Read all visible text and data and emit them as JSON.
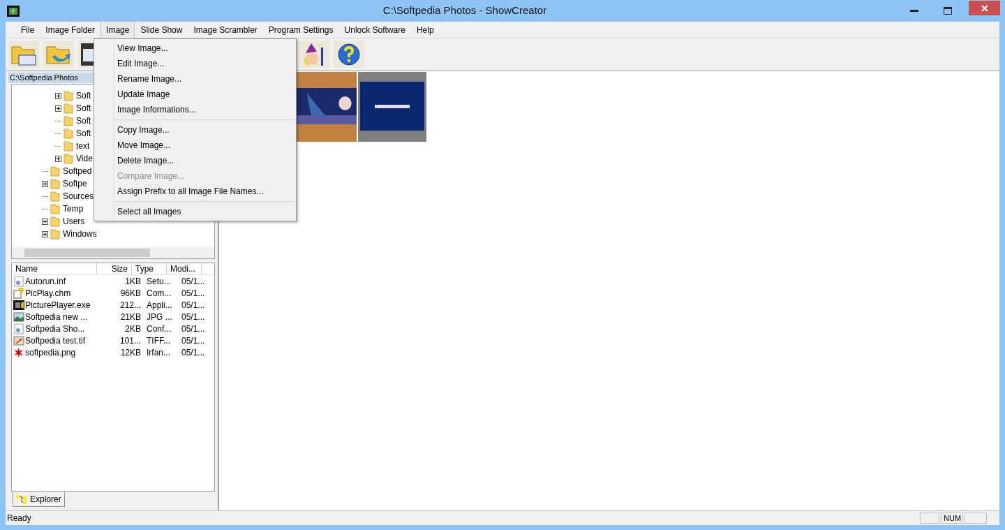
{
  "window": {
    "title": "C:\\Softpedia Photos - ShowCreator"
  },
  "menu_bar": [
    {
      "label": "File",
      "selected": false
    },
    {
      "label": "Image Folder",
      "selected": false
    },
    {
      "label": "Image",
      "selected": true
    },
    {
      "label": "Slide Show",
      "selected": false
    },
    {
      "label": "Image Scrambler",
      "selected": false
    },
    {
      "label": "Program Settings",
      "selected": false
    },
    {
      "label": "Unlock Software",
      "selected": false
    },
    {
      "label": "Help",
      "selected": false
    }
  ],
  "image_menu": [
    {
      "kind": "item",
      "label": "View Image...",
      "disabled": false
    },
    {
      "kind": "item",
      "label": "Edit Image...",
      "disabled": false
    },
    {
      "kind": "item",
      "label": "Rename Image...",
      "disabled": false
    },
    {
      "kind": "item",
      "label": "Update Image",
      "disabled": false
    },
    {
      "kind": "item",
      "label": "Image Informations...",
      "disabled": false
    },
    {
      "kind": "separator"
    },
    {
      "kind": "item",
      "label": "Copy Image...",
      "disabled": false
    },
    {
      "kind": "item",
      "label": "Move Image...",
      "disabled": false
    },
    {
      "kind": "item",
      "label": "Delete Image...",
      "disabled": false
    },
    {
      "kind": "item",
      "label": "Compare Image...",
      "disabled": true
    },
    {
      "kind": "item",
      "label": "Assign Prefix to all Image File Names...",
      "disabled": false
    },
    {
      "kind": "separator"
    },
    {
      "kind": "item",
      "label": "Select all Images",
      "disabled": false
    }
  ],
  "path_bar": "C:\\Softpedia Photos",
  "tree": {
    "deeper_items": [
      {
        "label": "Soft",
        "expandable": true
      },
      {
        "label": "Soft",
        "expandable": true
      },
      {
        "label": "Soft",
        "expandable": false
      },
      {
        "label": "Soft",
        "expandable": false
      },
      {
        "label": "text",
        "expandable": false
      },
      {
        "label": "Vide",
        "expandable": true
      }
    ],
    "items": [
      {
        "label": "Softped",
        "expandable": false
      },
      {
        "label": "Softpe",
        "expandable": true
      },
      {
        "label": "Sources",
        "expandable": false
      },
      {
        "label": "Temp",
        "expandable": false
      },
      {
        "label": "Users",
        "expandable": true
      },
      {
        "label": "Windows",
        "expandable": true
      }
    ]
  },
  "file_list": {
    "columns": [
      "Name",
      "Size",
      "Type",
      "Modi..."
    ],
    "rows": [
      {
        "kind": "settings",
        "cells": [
          "Autorun.inf",
          "1KB",
          "Setu...",
          "05/1..."
        ]
      },
      {
        "kind": "help",
        "cells": [
          "PicPlay.chm",
          "96KB",
          "Com...",
          "05/1..."
        ]
      },
      {
        "kind": "film",
        "cells": [
          "PicturePlayer.exe",
          "212...",
          "Appli...",
          "05/1..."
        ]
      },
      {
        "cells": [
          "Softpedia new ...",
          "21KB",
          "JPG ...",
          "05/1..."
        ]
      },
      {
        "kind": "settings",
        "cells": [
          "Softpedia Sho...",
          "2KB",
          "Conf...",
          "05/1..."
        ]
      },
      {
        "kind": "tiff",
        "cells": [
          "Softpedia test.tif",
          "101...",
          "TIFF...",
          "05/1..."
        ]
      },
      {
        "kind": "splash",
        "cells": [
          "softpedia.png",
          "12KB",
          "Irfan...",
          "05/1..."
        ]
      }
    ]
  },
  "tabs": [
    {
      "label": "Explorer",
      "selected": true
    }
  ],
  "status_bar": {
    "text": "Ready",
    "indicators": [
      "NUM"
    ]
  }
}
